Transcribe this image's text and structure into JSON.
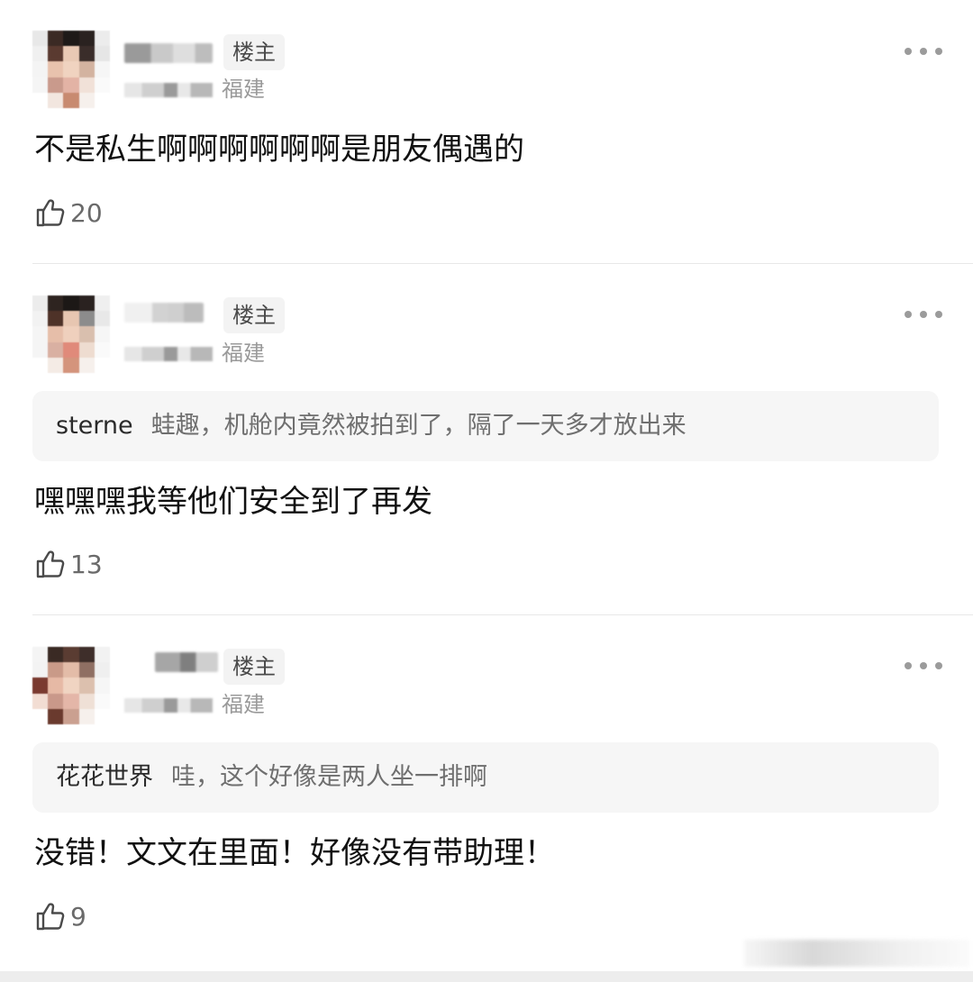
{
  "comments": [
    {
      "badge": "楼主",
      "location": "福建",
      "text": "不是私生啊啊啊啊啊啊是朋友偶遇的",
      "likes": "20"
    },
    {
      "badge": "楼主",
      "location": "福建",
      "quote": {
        "name": "sterne",
        "text": "蛙趣，机舱内竟然被拍到了，隔了一天多才放出来"
      },
      "text": "嘿嘿嘿我等他们安全到了再发",
      "likes": "13"
    },
    {
      "badge": "楼主",
      "location": "福建",
      "quote": {
        "name": "花花世界",
        "text": "哇，这个好像是两人坐一排啊"
      },
      "text": "没错！文文在里面！好像没有带助理！",
      "likes": "9"
    }
  ],
  "icons": {
    "like": "thumbs-up-icon",
    "more": "more-dots-icon"
  },
  "colors": {
    "background": "#ffffff",
    "quote_bg": "#f6f6f6",
    "badge_bg": "#f3f3f3",
    "meta_text": "#9a9a9a"
  }
}
